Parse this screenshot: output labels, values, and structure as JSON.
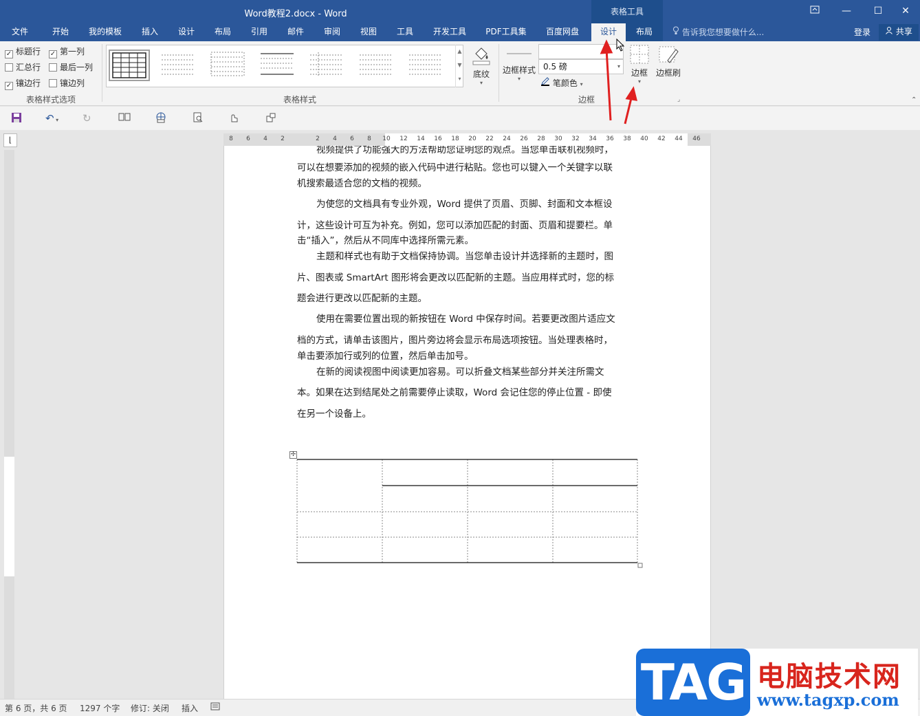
{
  "window": {
    "title": "Word教程2.docx - Word",
    "context_group": "表格工具",
    "restore_icon": "ribbon-display-icon",
    "minimize": "—",
    "maximize": "☐",
    "close": "✕"
  },
  "tabs": [
    "文件",
    "开始",
    "我的模板",
    "插入",
    "设计",
    "布局",
    "引用",
    "邮件",
    "审阅",
    "视图",
    "工具",
    "开发工具",
    "PDF工具集",
    "百度网盘",
    "设计",
    "布局"
  ],
  "active_tab_index": 14,
  "tellme": "告诉我您想要做什么...",
  "login": "登录",
  "share": "共享",
  "ribbon": {
    "style_options": {
      "header_row": "标题行",
      "first_column": "第一列",
      "total_row": "汇总行",
      "last_column": "最后一列",
      "banded_rows": "镶边行",
      "banded_columns": "镶边列",
      "group_label": "表格样式选项",
      "checked": {
        "header_row": true,
        "first_column": true,
        "total_row": false,
        "last_column": false,
        "banded_rows": true,
        "banded_columns": false
      }
    },
    "table_styles_label": "表格样式",
    "shading": "底纹",
    "border_styles": "边框样式",
    "pen_weight": "0.5 磅",
    "pen_color": "笔颜色",
    "borders": "边框",
    "border_painter": "边框刷",
    "borders_group_label": "边框"
  },
  "document": {
    "lines": [
      "视频提供了功能强大的方法帮助您证明您的观点。当您单击联机视频时，",
      "可以在想要添加的视频的嵌入代码中进行粘贴。您也可以键入一个关键字以联",
      "机搜索最适合您的文档的视频。",
      "为使您的文档具有专业外观，Word 提供了页眉、页脚、封面和文本框设",
      "计，这些设计可互为补充。例如，您可以添加匹配的封面、页眉和提要栏。单",
      "击“插入”，然后从不同库中选择所需元素。",
      "主题和样式也有助于文档保持协调。当您单击设计并选择新的主题时，图",
      "片、图表或 SmartArt 图形将会更改以匹配新的主题。当应用样式时，您的标",
      "题会进行更改以匹配新的主题。",
      "使用在需要位置出现的新按钮在 Word 中保存时间。若要更改图片适应文",
      "档的方式，请单击该图片，图片旁边将会显示布局选项按钮。当处理表格时，",
      "单击要添加行或列的位置，然后单击加号。",
      "在新的阅读视图中阅读更加容易。可以折叠文档某些部分并关注所需文",
      "本。如果在达到结尾处之前需要停止读取，Word 会记住您的停止位置 - 即使",
      "在另一个设备上。"
    ]
  },
  "ruler": {
    "ticks": [
      "8",
      "6",
      "4",
      "2",
      "2",
      "4",
      "6",
      "8",
      "10",
      "12",
      "14",
      "16",
      "18",
      "20",
      "22",
      "24",
      "26",
      "28",
      "30",
      "32",
      "34",
      "36",
      "38",
      "40",
      "42",
      "44",
      "46"
    ]
  },
  "status": {
    "page": "第 6 页，共 6 页",
    "words": "1297 个字",
    "track": "修订: 关闭",
    "mode": "插入"
  },
  "watermark": {
    "tag": "TAG",
    "cn": "电脑技术网",
    "url": "www.tagxp.com"
  },
  "colors": {
    "title_bar": "#2b579a",
    "context_tab": "#1e4e8c",
    "annotation_arrow": "#e02020"
  }
}
